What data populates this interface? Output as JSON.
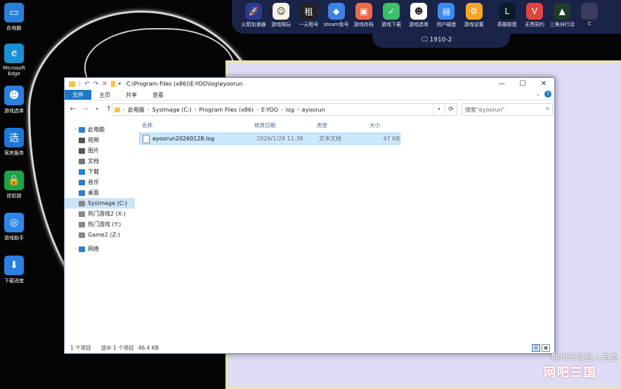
{
  "launcher": {
    "items": [
      {
        "label": "火箭加速器",
        "color": "#2a3a8c",
        "glyph": "🚀"
      },
      {
        "label": "游戏陪玩",
        "color": "#f7f2e6",
        "glyph": "☺"
      },
      {
        "label": "一元租号",
        "color": "#222222",
        "glyph": "租"
      },
      {
        "label": "steam免号",
        "color": "#3d82e0",
        "glyph": "◆"
      },
      {
        "label": "游戏存档",
        "color": "#f06a4a",
        "glyph": "▣"
      },
      {
        "label": "游戏下载",
        "color": "#3bbf6b",
        "glyph": "✓"
      },
      {
        "label": "游戏选单",
        "color": "#ffffff",
        "glyph": "☻"
      },
      {
        "label": "用户磁盘",
        "color": "#3c8cf0",
        "glyph": "▤"
      },
      {
        "label": "游戏设置",
        "color": "#f5a623",
        "glyph": "⚙"
      },
      {
        "label": "英雄联盟",
        "color": "#0a1a2a",
        "glyph": "L"
      },
      {
        "label": "无畏契约",
        "color": "#e0443e",
        "glyph": "V"
      },
      {
        "label": "三角洲行动",
        "color": "#1f3b2a",
        "glyph": "▲"
      },
      {
        "label": "C",
        "color": "#3b3b5c",
        "glyph": ""
      }
    ],
    "status": "1910-2"
  },
  "desktop": {
    "icons": [
      {
        "label": "此电脑",
        "color": "#2b7fd6",
        "glyph": "▭"
      },
      {
        "label": "Microsoft Edge",
        "color": "#1a8fd6",
        "glyph": "e"
      },
      {
        "label": "游戏选单",
        "color": "#2a7fe0",
        "glyph": "☻"
      },
      {
        "label": "客房服务",
        "color": "#1e78d8",
        "glyph": "选"
      },
      {
        "label": "挂机锁",
        "color": "#1fa34a",
        "glyph": "🔒"
      },
      {
        "label": "游戏助手",
        "color": "#2f86e8",
        "glyph": "◎"
      },
      {
        "label": "下载进度",
        "color": "#2a7fe0",
        "glyph": "⬇"
      }
    ]
  },
  "explorer": {
    "title": "C:\\Program Files (x86)\\E-YOO\\log\\eyoorun",
    "ribbon_tabs": [
      "文件",
      "主页",
      "共享",
      "查看"
    ],
    "breadcrumb": [
      "此电脑",
      "SysImage (C:)",
      "Program Files (x86)",
      "E-YOO",
      "log",
      "eyoorun"
    ],
    "search_placeholder": "搜索\"eyoorun\"",
    "nav_items": [
      {
        "label": "此电脑",
        "indent": 0,
        "color": "#2b7fd6",
        "selected": false
      },
      {
        "label": "视频",
        "indent": 1,
        "color": "#555555",
        "selected": false
      },
      {
        "label": "图片",
        "indent": 1,
        "color": "#555555",
        "selected": false
      },
      {
        "label": "文档",
        "indent": 1,
        "color": "#777777",
        "selected": false
      },
      {
        "label": "下载",
        "indent": 1,
        "color": "#2b7fd6",
        "selected": false
      },
      {
        "label": "音乐",
        "indent": 1,
        "color": "#2b7fd6",
        "selected": false
      },
      {
        "label": "桌面",
        "indent": 1,
        "color": "#2b7fd6",
        "selected": false
      },
      {
        "label": "SysImage (C:)",
        "indent": 1,
        "color": "#888888",
        "selected": true
      },
      {
        "label": "热门游戏2 (X:)",
        "indent": 1,
        "color": "#888888",
        "selected": false
      },
      {
        "label": "热门游戏 (Y:)",
        "indent": 1,
        "color": "#888888",
        "selected": false
      },
      {
        "label": "Game2 (Z:)",
        "indent": 1,
        "color": "#888888",
        "selected": false
      },
      {
        "label": "网络",
        "indent": 0,
        "color": "#2b7fd6",
        "selected": false
      }
    ],
    "columns": {
      "name": "名称",
      "date": "修改日期",
      "type": "类型",
      "size": "大小"
    },
    "files": [
      {
        "name": "eyoorun20260128.log",
        "date": "2026/1/28 11:38",
        "type": "文本文档",
        "size": "47 KB"
      }
    ],
    "status": {
      "count": "1 个项目",
      "selected": "选中 1 个项目",
      "size": "46.4 KB"
    }
  },
  "watermark": {
    "line1": "荆州市绿巨人电竞",
    "line2": "网吧三国"
  }
}
